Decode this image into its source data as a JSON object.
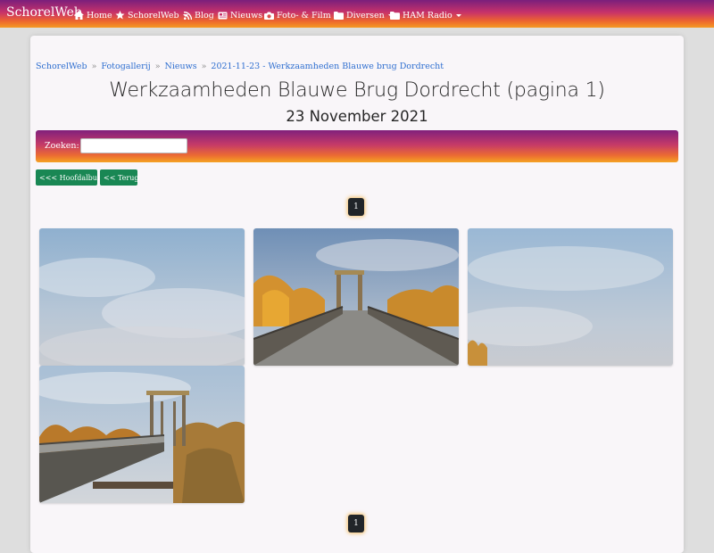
{
  "navbar": {
    "brand": "SchorelWeb",
    "items": [
      {
        "label": "Home",
        "icon": "home-icon"
      },
      {
        "label": "SchorelWeb",
        "icon": "star-icon",
        "dropdown": true
      },
      {
        "label": "Blog",
        "icon": "rss-icon"
      },
      {
        "label": "Nieuws",
        "icon": "newspaper-icon"
      },
      {
        "label": "Foto- & Film",
        "icon": "camera-icon",
        "dropdown": true
      },
      {
        "label": "Diversen",
        "icon": "folder-icon",
        "dropdown": true
      },
      {
        "label": "HAM Radio",
        "icon": "folder-icon",
        "dropdown": true
      }
    ]
  },
  "breadcrumb": [
    "SchorelWeb",
    "Fotogallerij",
    "Nieuws",
    "2021-11-23 - Werkzaamheden Blauwe brug Dordrecht"
  ],
  "page": {
    "title": "Werkzaamheden Blauwe Brug Dordrecht (pagina 1)",
    "subtitle": "23 November 2021"
  },
  "search": {
    "label": "Zoeken:",
    "value": "",
    "placeholder": ""
  },
  "buttons": {
    "main_album": "<<< Hoofdalbum",
    "back": "<< Terug"
  },
  "pagination": {
    "current": "1"
  },
  "gallery": {
    "photos": [
      {
        "subject": "cloudy-sky"
      },
      {
        "subject": "bridge-deck-view"
      },
      {
        "subject": "cloudy-sky-trees"
      },
      {
        "subject": "bridge-side-view"
      }
    ]
  },
  "colors": {
    "navbar_gradient": [
      "#7a1f7c",
      "#c8326a",
      "#ec6330",
      "#f59a23"
    ],
    "link": "#2f6fd0",
    "button_green": "#198754",
    "page_button": "#212529"
  }
}
